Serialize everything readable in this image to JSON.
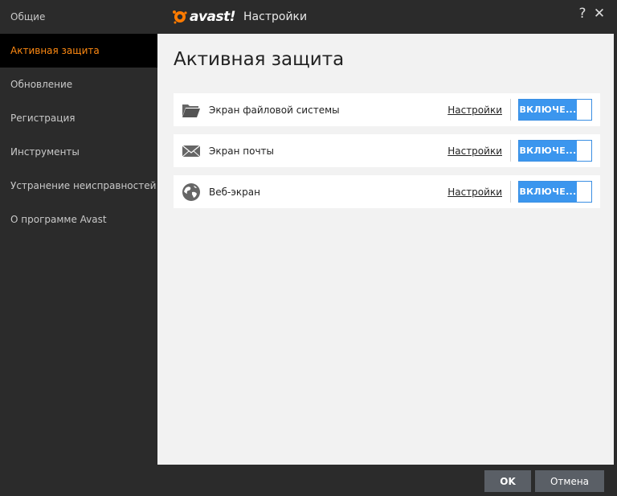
{
  "titlebar": {
    "logo_text": "avast!",
    "title": "Настройки",
    "help_glyph": "?",
    "close_glyph": "✕"
  },
  "sidebar": {
    "items": [
      {
        "label": "Общие",
        "active": false
      },
      {
        "label": "Активная защита",
        "active": true
      },
      {
        "label": "Обновление",
        "active": false
      },
      {
        "label": "Регистрация",
        "active": false
      },
      {
        "label": "Инструменты",
        "active": false
      },
      {
        "label": "Устранение неисправностей",
        "active": false
      },
      {
        "label": "О программе Avast",
        "active": false
      }
    ]
  },
  "main": {
    "title": "Активная защита",
    "shields": [
      {
        "icon": "folder-icon",
        "label": "Экран файловой системы",
        "link": "Настройки",
        "toggle": "ВКЛЮЧЕ..."
      },
      {
        "icon": "mail-icon",
        "label": "Экран почты",
        "link": "Настройки",
        "toggle": "ВКЛЮЧЕ..."
      },
      {
        "icon": "globe-icon",
        "label": "Веб-экран",
        "link": "Настройки",
        "toggle": "ВКЛЮЧЕ..."
      }
    ]
  },
  "footer": {
    "ok_label": "OK",
    "cancel_label": "Отмена"
  },
  "colors": {
    "accent": "#ff8a12",
    "toggle_on": "#3b96ee",
    "sidebar_bg": "#2b2b2b",
    "content_bg": "#f2f2f2"
  }
}
